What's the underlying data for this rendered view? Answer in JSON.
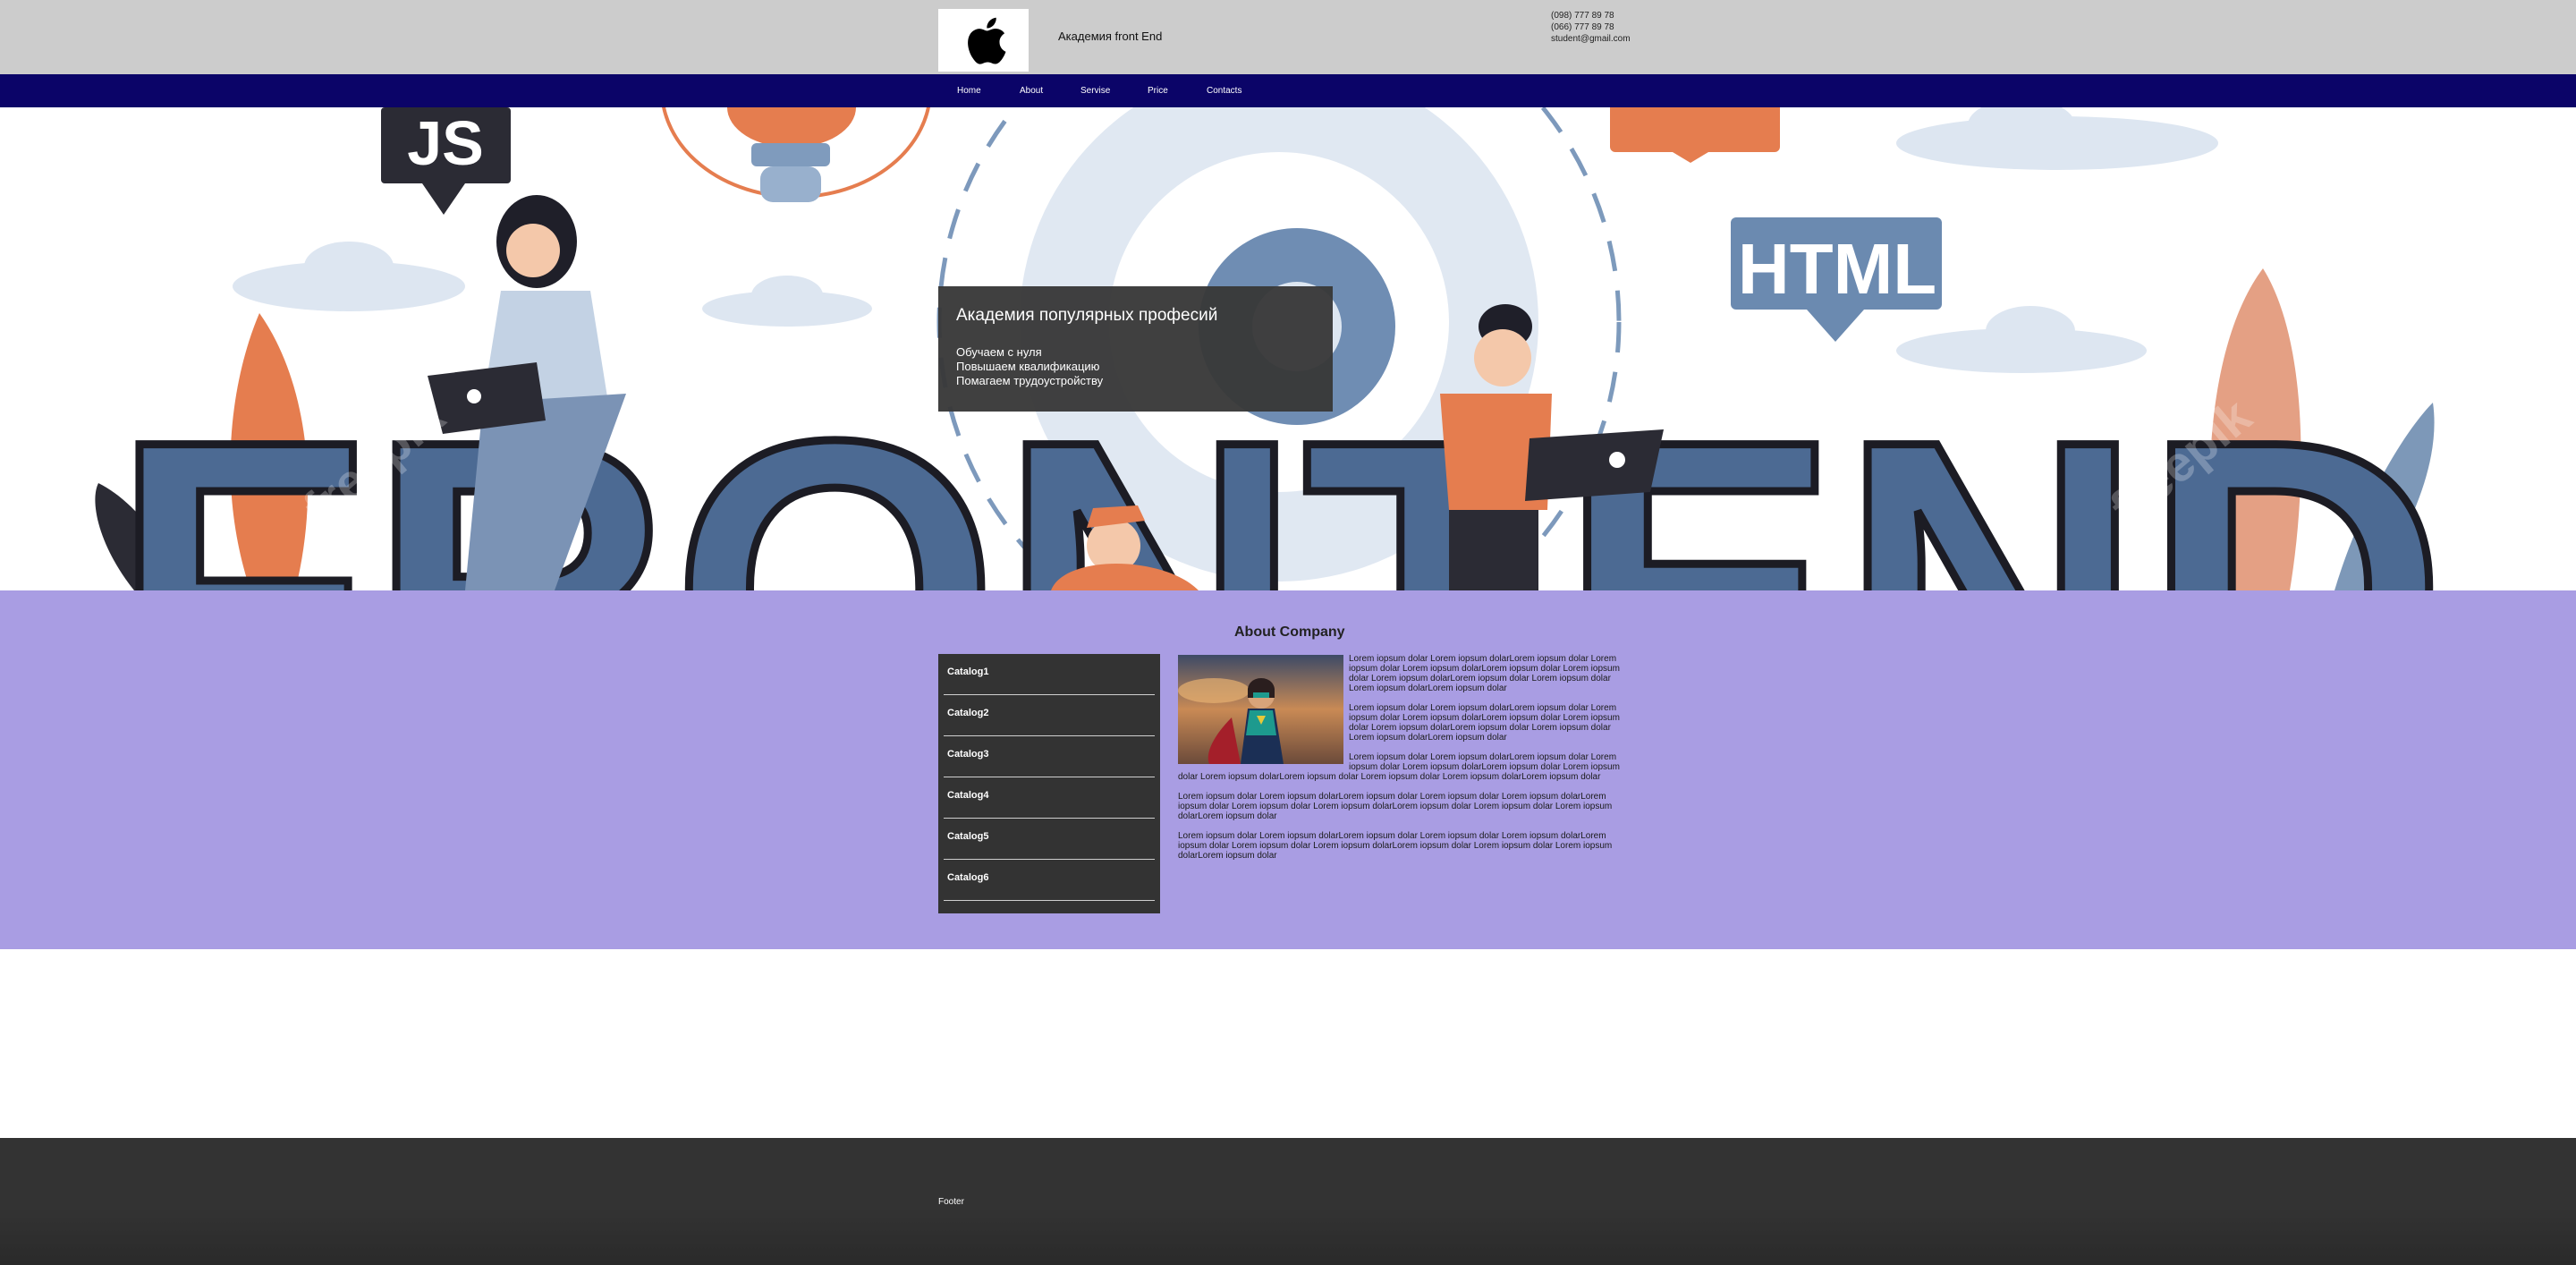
{
  "header": {
    "title": "Академия front End",
    "logo_icon": "apple-logo-icon",
    "phone1": "(098) 777 89 78",
    "phone2": "(066) 777 89 78",
    "email": "student@gmail.com"
  },
  "nav": {
    "items": [
      "Home",
      "About",
      "Servise",
      "Price",
      "Contacts"
    ],
    "background": "#0b0468"
  },
  "hero": {
    "title": "Академия популярных професий",
    "lines": [
      "Обучаем с нуля",
      "Повышаем квалификацию",
      "Помагаем трудоустройству"
    ],
    "illustration": {
      "big_word": "FRONTEND",
      "badge_js": "JS",
      "badge_html": "HTML",
      "watermark": "freepik"
    }
  },
  "about": {
    "title": "About Company",
    "background": "#a99de3",
    "catalog": [
      "Catalog1",
      "Catalog2",
      "Catalog3",
      "Catalog4",
      "Catalog5",
      "Catalog6"
    ],
    "paragraphs": [
      "Lorem iopsum dolar Lorem iopsum dolarLorem iopsum dolar Lorem iopsum dolar Lorem iopsum dolarLorem iopsum dolar Lorem iopsum dolar Lorem iopsum dolarLorem iopsum dolar Lorem iopsum dolar Lorem iopsum dolarLorem iopsum dolar",
      "Lorem iopsum dolar Lorem iopsum dolarLorem iopsum dolar Lorem iopsum dolar Lorem iopsum dolarLorem iopsum dolar Lorem iopsum dolar Lorem iopsum dolarLorem iopsum dolar Lorem iopsum dolar Lorem iopsum dolarLorem iopsum dolar",
      "Lorem iopsum dolar Lorem iopsum dolarLorem iopsum dolar Lorem iopsum dolar Lorem iopsum dolarLorem iopsum dolar Lorem iopsum dolar Lorem iopsum dolarLorem iopsum dolar Lorem iopsum dolar Lorem iopsum dolarLorem iopsum dolar",
      "Lorem iopsum dolar Lorem iopsum dolarLorem iopsum dolar Lorem iopsum dolar Lorem iopsum dolarLorem iopsum dolar Lorem iopsum dolar Lorem iopsum dolarLorem iopsum dolar Lorem iopsum dolar Lorem iopsum dolarLorem iopsum dolar",
      "Lorem iopsum dolar Lorem iopsum dolarLorem iopsum dolar Lorem iopsum dolar Lorem iopsum dolarLorem iopsum dolar Lorem iopsum dolar Lorem iopsum dolarLorem iopsum dolar Lorem iopsum dolar Lorem iopsum dolarLorem iopsum dolar"
    ]
  },
  "footer": {
    "text": "Footer"
  }
}
